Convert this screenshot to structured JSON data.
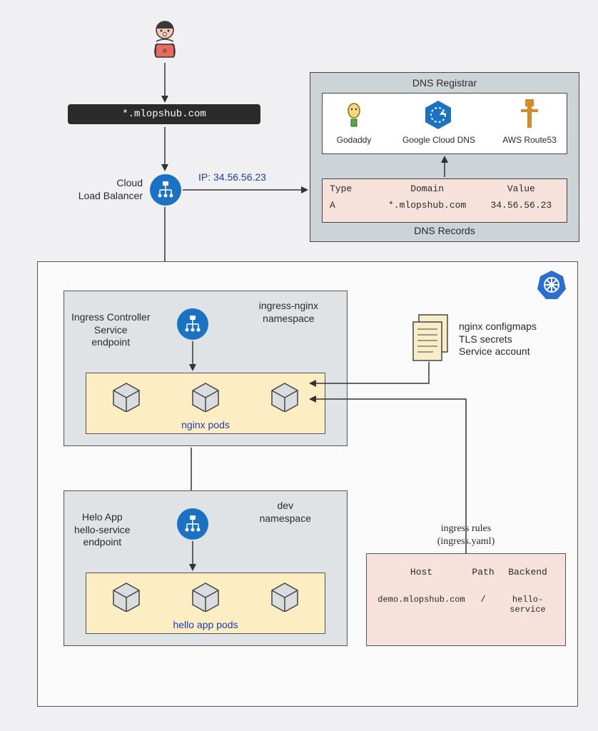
{
  "domain_bar": "*.mlopshub.com",
  "cloud_lb_label": "Cloud\nLoad Balancer",
  "ip_label": "IP: 34.56.56.23",
  "dns": {
    "title": "DNS Registrar",
    "providers": {
      "godaddy": "Godaddy",
      "gcloud": "Google Cloud DNS",
      "route53": "AWS Route53"
    },
    "records_title": "DNS Records",
    "headers": {
      "type": "Type",
      "domain": "Domain",
      "value": "Value"
    },
    "row": {
      "type": "A",
      "domain": "*.mlopshub.com",
      "value": "34.56.56.23"
    }
  },
  "k8s": {
    "ns_ingress": {
      "label": "ingress-nginx\nnamespace",
      "svc_label": "Ingress Controller\nService\nendpoint",
      "pods_label": "nginx pods"
    },
    "configmaps_label": "nginx configmaps\nTLS secrets\nService account",
    "ns_dev": {
      "label": "dev\nnamespace",
      "svc_label": "Helo App\nhello-service\nendpoint",
      "pods_label": "hello app pods"
    },
    "ingress_rules": {
      "title": "ingress rules\n(ingress.yaml)",
      "headers": {
        "host": "Host",
        "path": "Path",
        "backend": "Backend"
      },
      "row": {
        "host": "demo.mlopshub.com",
        "path": "/",
        "backend": "hello-service"
      }
    }
  }
}
